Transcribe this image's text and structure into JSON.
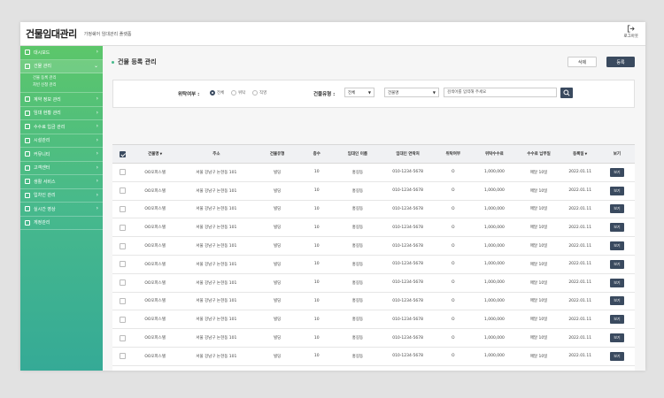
{
  "app": {
    "title": "건물임대관리",
    "subtitle": "가정쉐어 임대관리 플랫폼",
    "logout_label": "로그아웃"
  },
  "sidebar": {
    "items": [
      {
        "label": "대시보드"
      },
      {
        "label": "건물 관리"
      },
      {
        "label": "계약 정보 관리"
      },
      {
        "label": "임대 현황 관리"
      },
      {
        "label": "수수료 입금 관리"
      },
      {
        "label": "시설관리"
      },
      {
        "label": "커뮤니티"
      },
      {
        "label": "고객센터"
      },
      {
        "label": "생활 서비스"
      },
      {
        "label": "입차인 관리"
      },
      {
        "label": "실시간 영상"
      },
      {
        "label": "게정관리"
      }
    ],
    "sub_items": [
      {
        "label": "건물 등록 관리"
      },
      {
        "label": "차빈 신청 관리"
      }
    ]
  },
  "page": {
    "title": "건물 등록 관리",
    "delete_label": "삭제",
    "register_label": "등록"
  },
  "filter": {
    "entrust_label": "위탁여부 :",
    "radios": [
      {
        "label": "전체"
      },
      {
        "label": "위탁"
      },
      {
        "label": "직영"
      }
    ],
    "type_label": "건물유형 :",
    "type_value": "전체",
    "field_value": "건물명",
    "search_placeholder": "검색어를 입력해 주세요"
  },
  "table": {
    "headers": [
      "건물명",
      "주소",
      "건물유형",
      "층수",
      "임대인 이름",
      "임대인 연락처",
      "위탁여부",
      "위탁수수료",
      "수수료 납부일",
      "등록일",
      "보기"
    ],
    "view_label": "보기",
    "rows": [
      [
        "OO오피스텔",
        "서울 강남구 논현동 101",
        "빌딩",
        "10",
        "홍길동",
        "010-1234-5678",
        "O",
        "1,000,000",
        "매달 10일",
        "2022.01.11"
      ],
      [
        "OO오피스텔",
        "서울 강남구 논현동 101",
        "빌딩",
        "10",
        "홍길동",
        "010-1234-5678",
        "O",
        "1,000,000",
        "매달 10일",
        "2022.01.11"
      ],
      [
        "OO오피스텔",
        "서울 강남구 논현동 101",
        "빌딩",
        "10",
        "홍길동",
        "010-1234-5678",
        "O",
        "1,000,000",
        "매달 10일",
        "2022.01.11"
      ],
      [
        "OO오피스텔",
        "서울 강남구 논현동 101",
        "빌딩",
        "10",
        "홍길동",
        "010-1234-5678",
        "O",
        "1,000,000",
        "매달 10일",
        "2022.01.11"
      ],
      [
        "OO오피스텔",
        "서울 강남구 논현동 101",
        "빌딩",
        "10",
        "홍길동",
        "010-1234-5678",
        "O",
        "1,000,000",
        "매달 10일",
        "2022.01.11"
      ],
      [
        "OO오피스텔",
        "서울 강남구 논현동 101",
        "빌딩",
        "10",
        "홍길동",
        "010-1234-5678",
        "O",
        "1,000,000",
        "매달 10일",
        "2022.01.11"
      ],
      [
        "OO오피스텔",
        "서울 강남구 논현동 101",
        "빌딩",
        "10",
        "홍길동",
        "010-1234-5678",
        "O",
        "1,000,000",
        "매달 10일",
        "2022.01.11"
      ],
      [
        "OO오피스텔",
        "서울 강남구 논현동 101",
        "빌딩",
        "10",
        "홍길동",
        "010-1234-5678",
        "O",
        "1,000,000",
        "매달 10일",
        "2022.01.11"
      ],
      [
        "OO오피스텔",
        "서울 강남구 논현동 101",
        "빌딩",
        "10",
        "홍길동",
        "010-1234-5678",
        "O",
        "1,000,000",
        "매달 10일",
        "2022.01.11"
      ],
      [
        "OO오피스텔",
        "서울 강남구 논현동 101",
        "빌딩",
        "10",
        "홍길동",
        "010-1234-5678",
        "O",
        "1,000,000",
        "매달 10일",
        "2022.01.11"
      ],
      [
        "OO오피스텔",
        "서울 강남구 논현동 101",
        "빌딩",
        "10",
        "홍길동",
        "010-1234-5678",
        "O",
        "1,000,000",
        "매달 10일",
        "2022.01.11"
      ],
      [
        "OO오피스텔",
        "서울 강남구 논현동 101",
        "빌딩",
        "10",
        "홍길동",
        "010-1234-5678",
        "O",
        "1,000,000",
        "매달 10일",
        "2022.01.11"
      ],
      [
        "OO오피스텔",
        "서울 강남구 논현동 101",
        "빌딩",
        "10",
        "홍길동",
        "010-1234-5678",
        "O",
        "1,000,000",
        "매달 10일",
        "2022.01.11"
      ]
    ]
  },
  "colors": {
    "accent": "#47b98c",
    "primary_button": "#3a4a5f",
    "sidebar_top": "#5cc66a",
    "sidebar_bottom": "#35aa96"
  }
}
